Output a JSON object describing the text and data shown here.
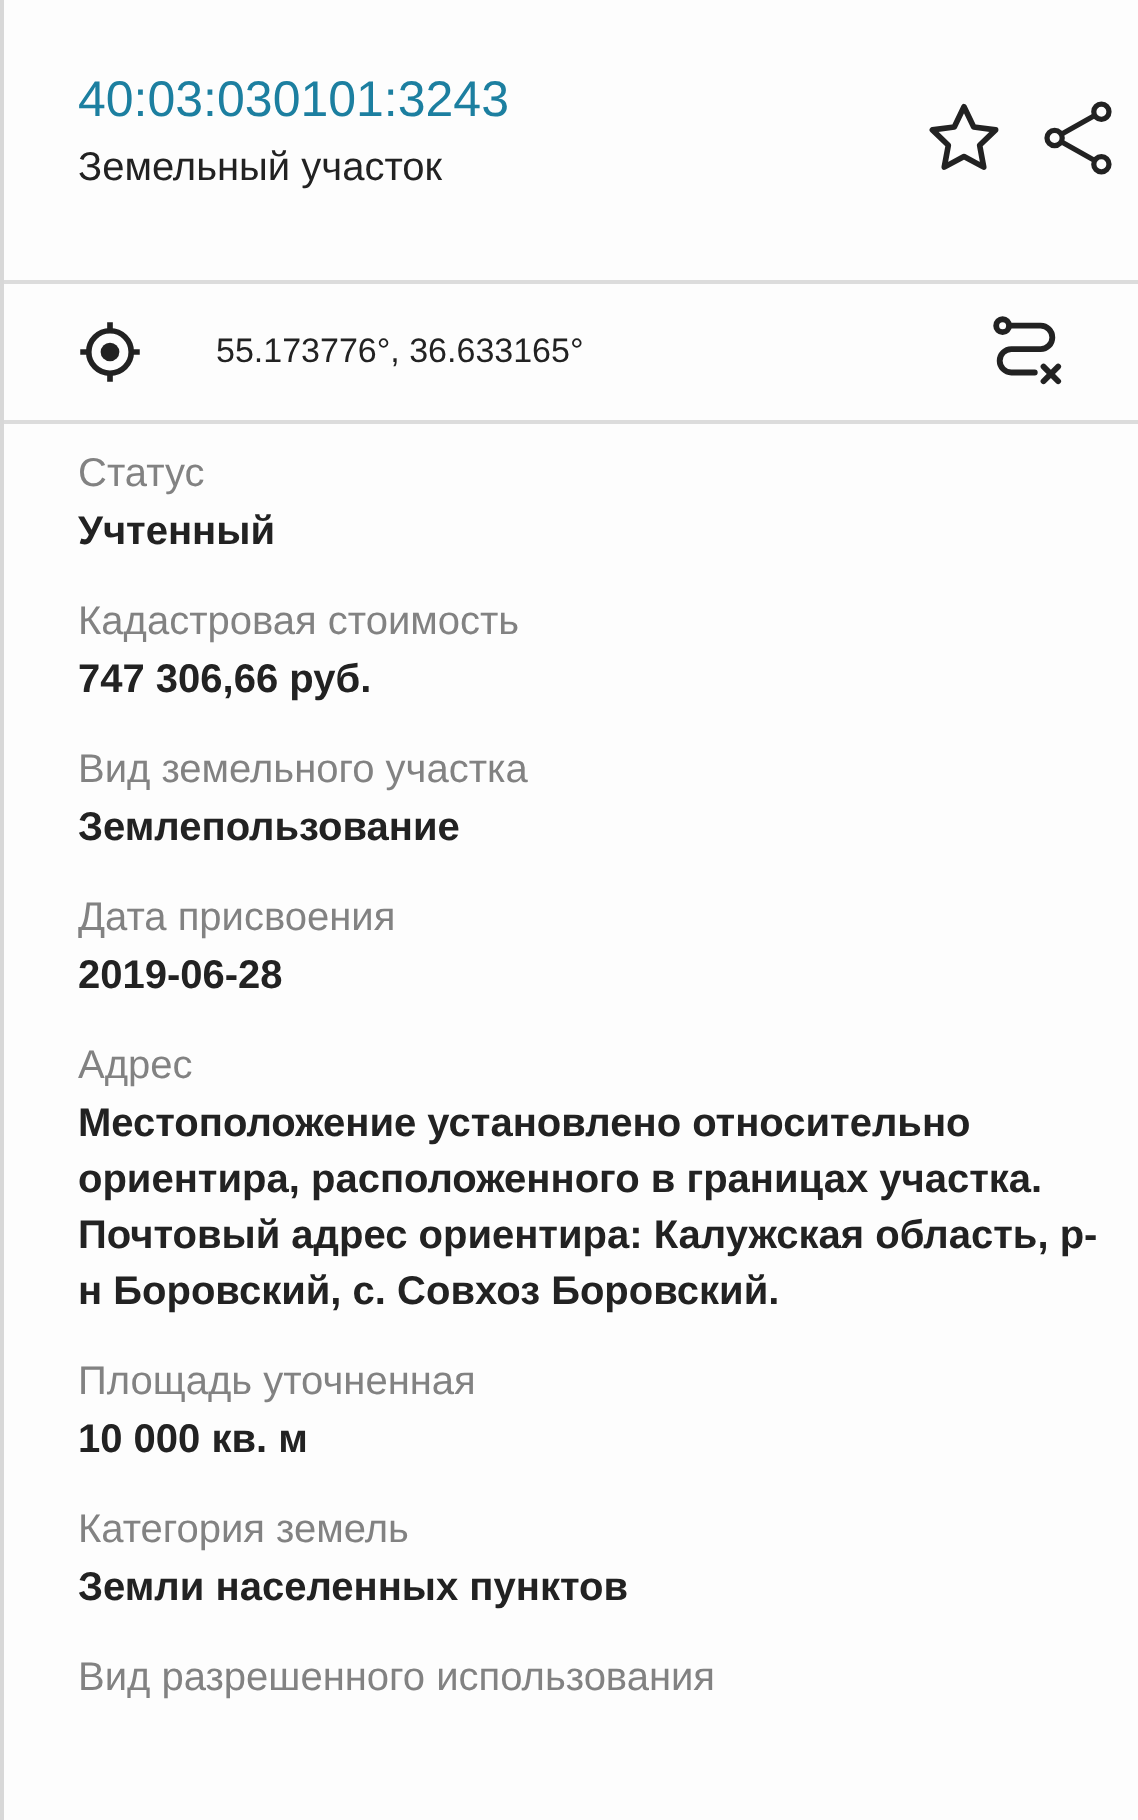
{
  "header": {
    "cadastral_number": "40:03:030101:3243",
    "object_type": "Земельный участок"
  },
  "coordinates": {
    "text": "55.173776°, 36.633165°"
  },
  "fields": [
    {
      "label": "Статус",
      "value": "Учтенный"
    },
    {
      "label": "Кадастровая стоимость",
      "value": "747 306,66 руб."
    },
    {
      "label": "Вид земельного участка",
      "value": "Землепользование"
    },
    {
      "label": "Дата присвоения",
      "value": "2019-06-28"
    },
    {
      "label": "Адрес",
      "value": "Местоположение установлено относительно ориентира, расположенного в границах участка. Почтовый адрес ориентира: Калужская область, р-н Боровский, с. Совхоз Боровский."
    },
    {
      "label": "Площадь уточненная",
      "value": "10 000 кв. м"
    },
    {
      "label": "Категория земель",
      "value": "Земли населенных пунктов"
    },
    {
      "label": "Вид разрешенного использования"
    }
  ]
}
